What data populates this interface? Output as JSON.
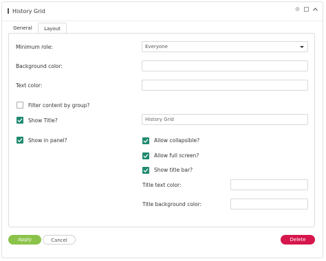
{
  "header": {
    "title": "History Grid"
  },
  "tabs": [
    {
      "label": "General"
    },
    {
      "label": "Layout"
    }
  ],
  "form": {
    "minimum_role": {
      "label": "Minimum role:",
      "value": "Everyone"
    },
    "background_color": {
      "label": "Background color:",
      "value": ""
    },
    "text_color": {
      "label": "Text color:",
      "value": ""
    },
    "filter_by_group": {
      "label": "Filter content by group?",
      "checked": false
    },
    "show_title": {
      "label": "Show Title?",
      "checked": true,
      "title_value": "History Grid"
    },
    "show_in_panel": {
      "label": "Show in panel?",
      "checked": true
    },
    "allow_collapsible": {
      "label": "Allow collapsible?",
      "checked": true
    },
    "allow_full_screen": {
      "label": "Allow full screen?",
      "checked": true
    },
    "show_title_bar": {
      "label": "Show title bar?",
      "checked": true
    },
    "title_text_color": {
      "label": "Title text color:",
      "value": ""
    },
    "title_background_color": {
      "label": "Title background color:",
      "value": ""
    }
  },
  "footer": {
    "apply_label": "Apply",
    "cancel_label": "Cancel",
    "delete_label": "Delete"
  },
  "colors": {
    "checkbox": "#1f8a70",
    "apply": "#8bc34a",
    "delete": "#d6164d"
  },
  "icons": {
    "header": [
      "gear-icon",
      "maximize-icon",
      "collapse-icon"
    ]
  }
}
